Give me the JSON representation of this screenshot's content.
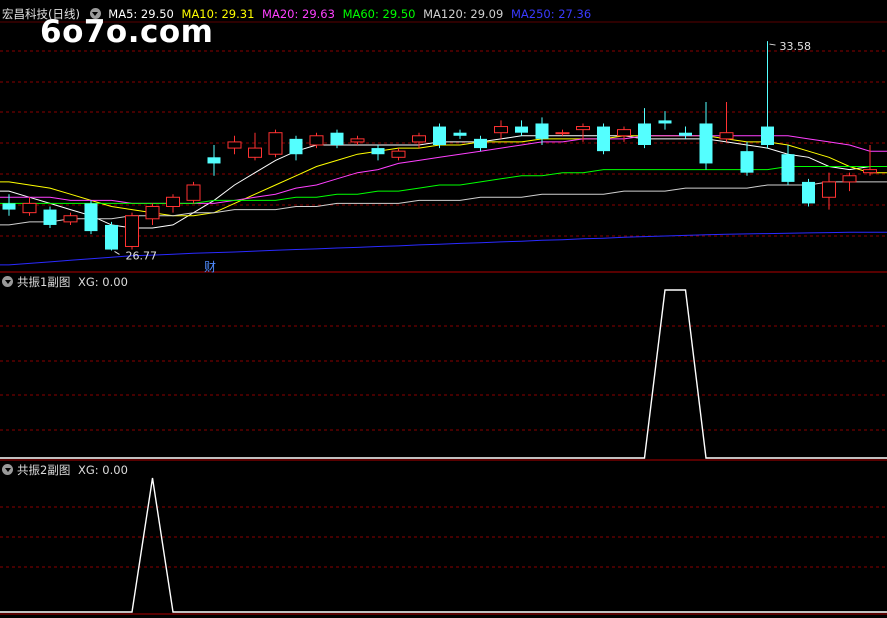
{
  "header": {
    "stock": "宏昌科技(日线)",
    "ma": [
      {
        "label": "MA5: 29.50",
        "color": "#ffffff"
      },
      {
        "label": "MA10: 29.31",
        "color": "#ffff00"
      },
      {
        "label": "MA20: 29.63",
        "color": "#ff40ff"
      },
      {
        "label": "MA60: 29.50",
        "color": "#00ff00"
      },
      {
        "label": "MA120: 29.09",
        "color": "#d0d0d0"
      },
      {
        "label": "MA250: 27.36",
        "color": "#2a2aff"
      }
    ]
  },
  "watermark": "6o7o.com",
  "fin_marker": "财",
  "panel1": {
    "title": "共振1副图",
    "xg": "XG: 0.00"
  },
  "panel2": {
    "title": "共振2副图",
    "xg": "XG: 0.00"
  },
  "chart_data": [
    {
      "type": "candlestick",
      "ylim": [
        26.2,
        34.2
      ],
      "high_label": "33.58",
      "low_label": "26.77",
      "candles": [
        [
          28.3,
          28.1,
          28.6,
          27.9
        ],
        [
          28.0,
          28.3,
          28.5,
          27.9
        ],
        [
          28.1,
          27.6,
          28.2,
          27.5
        ],
        [
          27.7,
          27.9,
          28.0,
          27.6
        ],
        [
          28.3,
          27.4,
          28.4,
          27.3
        ],
        [
          27.6,
          26.8,
          27.7,
          26.77
        ],
        [
          26.9,
          27.9,
          28.0,
          26.8
        ],
        [
          27.8,
          28.2,
          28.3,
          27.6
        ],
        [
          28.2,
          28.5,
          28.6,
          28.0
        ],
        [
          28.4,
          28.9,
          29.0,
          28.3
        ],
        [
          29.8,
          29.6,
          30.2,
          29.2
        ],
        [
          30.1,
          30.3,
          30.5,
          29.9
        ],
        [
          29.8,
          30.1,
          30.6,
          29.7
        ],
        [
          29.9,
          30.6,
          30.7,
          29.8
        ],
        [
          30.4,
          29.9,
          30.5,
          29.7
        ],
        [
          30.2,
          30.5,
          30.6,
          30.1
        ],
        [
          30.6,
          30.2,
          30.7,
          30.1
        ],
        [
          30.3,
          30.4,
          30.5,
          30.2
        ],
        [
          30.1,
          29.9,
          30.2,
          29.7
        ],
        [
          29.8,
          30.0,
          30.1,
          29.7
        ],
        [
          30.3,
          30.5,
          30.6,
          30.1
        ],
        [
          30.8,
          30.2,
          30.9,
          30.1
        ],
        [
          30.6,
          30.5,
          30.7,
          30.4
        ],
        [
          30.4,
          30.1,
          30.5,
          30.0
        ],
        [
          30.6,
          30.8,
          31.0,
          30.4
        ],
        [
          30.8,
          30.6,
          31.0,
          30.5
        ],
        [
          30.9,
          30.4,
          31.1,
          30.2
        ],
        [
          30.6,
          30.6,
          30.7,
          30.5
        ],
        [
          30.7,
          30.8,
          30.9,
          30.3
        ],
        [
          30.8,
          30.0,
          30.9,
          29.9
        ],
        [
          30.5,
          30.7,
          30.8,
          30.3
        ],
        [
          30.9,
          30.2,
          31.4,
          30.1
        ],
        [
          31.0,
          30.9,
          31.3,
          30.7
        ],
        [
          30.6,
          30.5,
          30.8,
          30.4
        ],
        [
          30.9,
          29.6,
          31.6,
          29.4
        ],
        [
          30.4,
          30.6,
          31.6,
          30.3
        ],
        [
          30.0,
          29.3,
          30.3,
          29.2
        ],
        [
          30.8,
          30.2,
          33.58,
          30.1
        ],
        [
          29.9,
          29.0,
          30.2,
          28.9
        ],
        [
          29.0,
          28.3,
          29.1,
          28.2
        ],
        [
          28.5,
          29.0,
          29.3,
          28.1
        ],
        [
          29.0,
          29.2,
          29.3,
          28.7
        ],
        [
          29.3,
          29.4,
          30.2,
          29.2
        ]
      ],
      "ma_series": [
        {
          "label": "MA5",
          "color": "#ffffff",
          "values": [
            28.7,
            28.5,
            28.3,
            28.1,
            27.9,
            27.6,
            27.5,
            27.5,
            27.6,
            28.0,
            28.4,
            28.9,
            29.3,
            29.7,
            30.0,
            30.2,
            30.2,
            30.2,
            30.2,
            30.2,
            30.2,
            30.3,
            30.3,
            30.3,
            30.4,
            30.5,
            30.5,
            30.5,
            30.5,
            30.5,
            30.5,
            30.4,
            30.4,
            30.4,
            30.4,
            30.3,
            30.2,
            30.1,
            29.9,
            29.8,
            29.5,
            29.4,
            29.5
          ]
        },
        {
          "label": "MA10",
          "color": "#ffff00",
          "values": [
            29.0,
            28.9,
            28.8,
            28.6,
            28.4,
            28.2,
            28.1,
            28.0,
            27.9,
            27.9,
            28.0,
            28.3,
            28.6,
            28.9,
            29.2,
            29.5,
            29.7,
            29.9,
            30.0,
            30.1,
            30.1,
            30.2,
            30.2,
            30.3,
            30.3,
            30.3,
            30.4,
            30.4,
            30.4,
            30.4,
            30.5,
            30.5,
            30.5,
            30.5,
            30.5,
            30.4,
            30.3,
            30.3,
            30.2,
            30.0,
            29.8,
            29.5,
            29.3
          ]
        },
        {
          "label": "MA20",
          "color": "#ff40ff",
          "values": [
            28.5,
            28.5,
            28.5,
            28.4,
            28.4,
            28.4,
            28.3,
            28.3,
            28.3,
            28.3,
            28.3,
            28.4,
            28.5,
            28.6,
            28.8,
            28.9,
            29.1,
            29.3,
            29.4,
            29.6,
            29.7,
            29.8,
            29.9,
            30.0,
            30.1,
            30.2,
            30.3,
            30.3,
            30.4,
            30.4,
            30.4,
            30.5,
            30.5,
            30.5,
            30.5,
            30.5,
            30.5,
            30.5,
            30.5,
            30.4,
            30.3,
            30.2,
            30.0
          ]
        },
        {
          "label": "MA60",
          "color": "#00ff00",
          "values": [
            28.3,
            28.3,
            28.3,
            28.3,
            28.3,
            28.3,
            28.3,
            28.3,
            28.3,
            28.3,
            28.4,
            28.4,
            28.4,
            28.4,
            28.5,
            28.5,
            28.6,
            28.6,
            28.7,
            28.7,
            28.8,
            28.9,
            28.9,
            29.0,
            29.1,
            29.2,
            29.2,
            29.3,
            29.3,
            29.4,
            29.4,
            29.4,
            29.4,
            29.4,
            29.4,
            29.4,
            29.4,
            29.4,
            29.5,
            29.5,
            29.5,
            29.5,
            29.5
          ]
        },
        {
          "label": "MA120",
          "color": "#d0d0d0",
          "values": [
            27.6,
            27.7,
            27.7,
            27.8,
            27.8,
            27.8,
            27.9,
            27.9,
            27.9,
            28.0,
            28.0,
            28.1,
            28.1,
            28.1,
            28.2,
            28.2,
            28.3,
            28.3,
            28.3,
            28.3,
            28.4,
            28.4,
            28.4,
            28.5,
            28.5,
            28.5,
            28.6,
            28.6,
            28.6,
            28.6,
            28.7,
            28.7,
            28.7,
            28.8,
            28.8,
            28.8,
            28.8,
            28.9,
            28.9,
            28.9,
            29.0,
            29.0,
            29.0
          ]
        },
        {
          "label": "MA250",
          "color": "#2a2aff",
          "values": [
            26.3,
            26.35,
            26.4,
            26.45,
            26.5,
            26.55,
            26.6,
            26.62,
            26.65,
            26.68,
            26.7,
            26.72,
            26.75,
            26.78,
            26.8,
            26.82,
            26.85,
            26.87,
            26.9,
            26.92,
            26.95,
            26.97,
            27.0,
            27.02,
            27.05,
            27.07,
            27.1,
            27.12,
            27.15,
            27.17,
            27.2,
            27.22,
            27.24,
            27.26,
            27.28,
            27.3,
            27.31,
            27.32,
            27.33,
            27.34,
            27.35,
            27.36,
            27.36
          ]
        }
      ]
    },
    {
      "type": "line",
      "ylim": [
        0,
        1
      ],
      "series": [
        {
          "values": [
            0,
            0,
            0,
            0,
            0,
            0,
            0,
            0,
            0,
            0,
            0,
            0,
            0,
            0,
            0,
            0,
            0,
            0,
            0,
            0,
            0,
            0,
            0,
            0,
            0,
            0,
            0,
            0,
            0,
            0,
            0,
            0,
            1,
            1,
            0,
            0,
            0,
            0,
            0,
            0,
            0,
            0,
            0
          ]
        }
      ]
    },
    {
      "type": "line",
      "ylim": [
        0,
        1
      ],
      "series": [
        {
          "values": [
            0,
            0,
            0,
            0,
            0,
            0,
            0,
            1,
            0,
            0,
            0,
            0,
            0,
            0,
            0,
            0,
            0,
            0,
            0,
            0,
            0,
            0,
            0,
            0,
            0,
            0,
            0,
            0,
            0,
            0,
            0,
            0,
            0,
            0,
            0,
            0,
            0,
            0,
            0,
            0,
            0,
            0,
            0
          ]
        }
      ]
    }
  ]
}
